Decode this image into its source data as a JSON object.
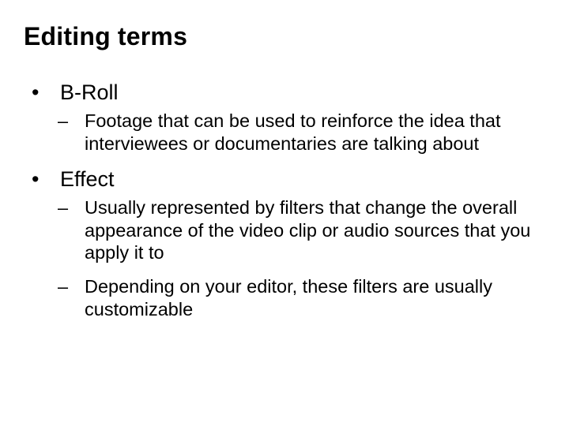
{
  "slide": {
    "title": "Editing terms",
    "items": [
      {
        "term": "B-Roll",
        "subs": [
          "Footage that can be used to reinforce the idea that interviewees or documentaries are talking about"
        ]
      },
      {
        "term": "Effect",
        "subs": [
          "Usually represented by filters that change the overall appearance of the video clip or audio sources that you apply it to",
          "Depending on your editor, these filters are usually customizable"
        ]
      }
    ]
  }
}
